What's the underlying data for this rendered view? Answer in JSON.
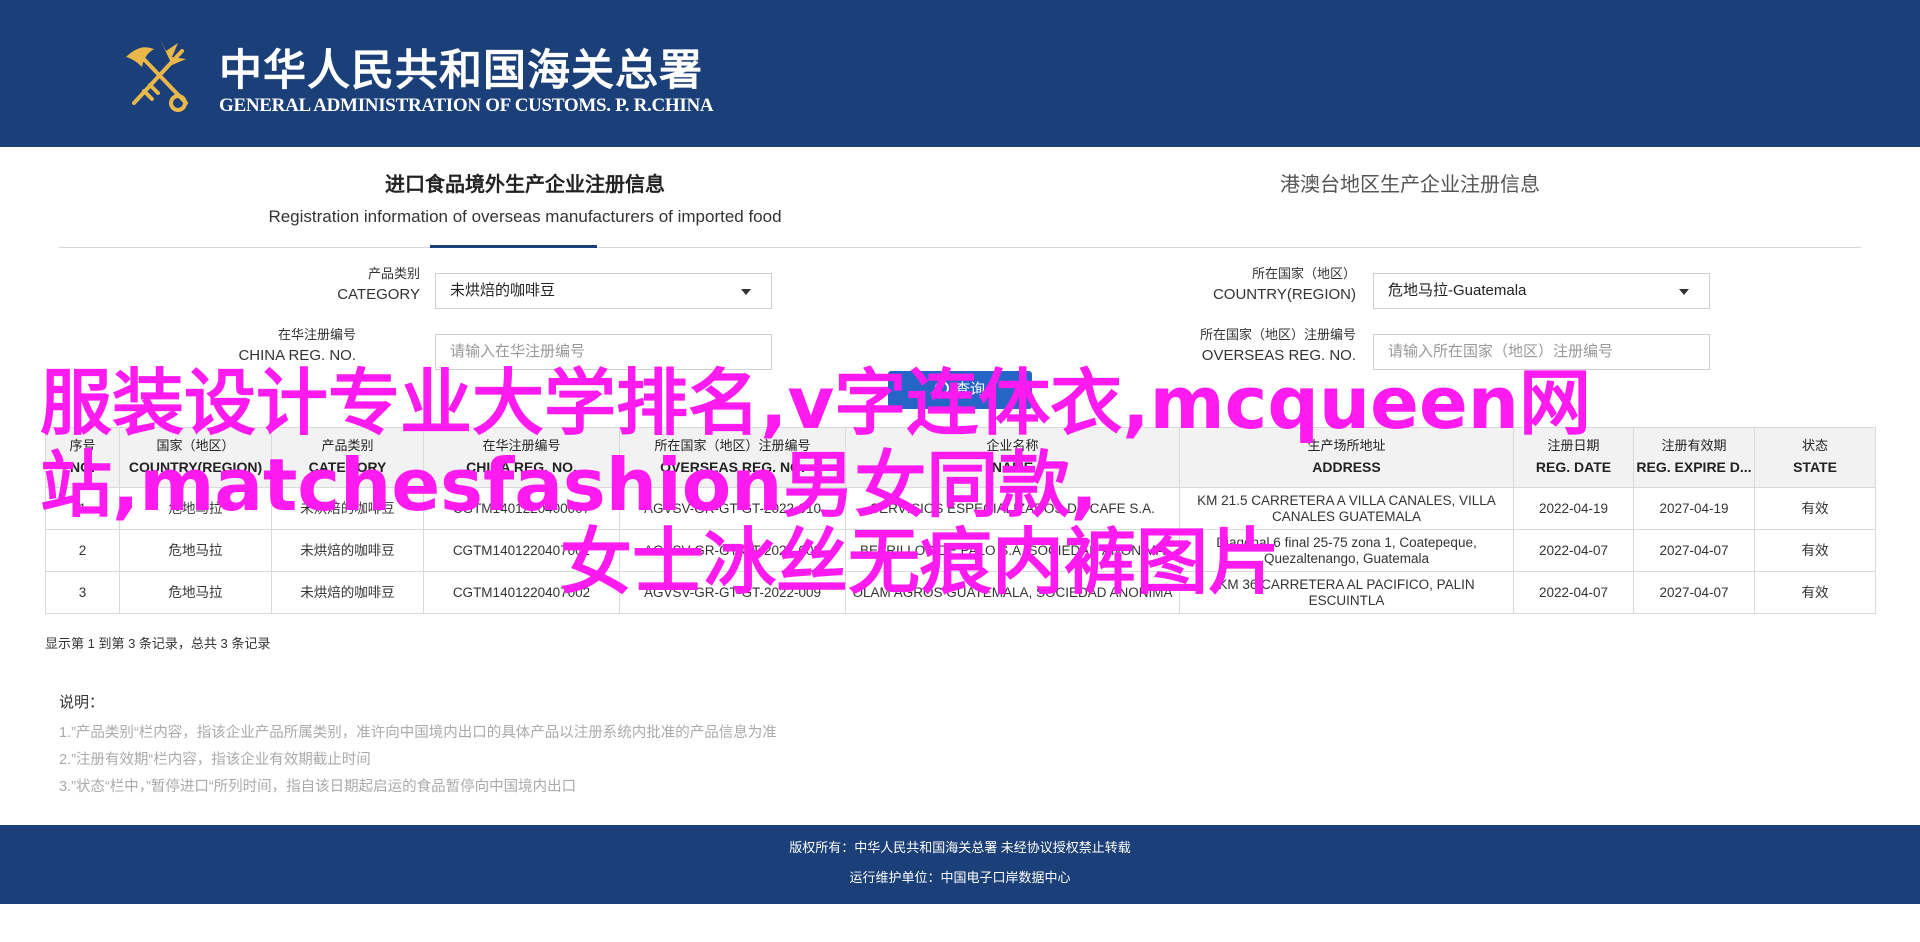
{
  "header": {
    "title_cn": "中华人民共和国海关总署",
    "title_en": "GENERAL ADMINISTRATION OF CUSTOMS. P. R.CHINA",
    "emblem_icon": "customs-emblem-icon"
  },
  "tabs": {
    "left_cn": "进口食品境外生产企业注册信息",
    "left_en": "Registration information of overseas manufacturers of imported food",
    "right_cn": "港澳台地区生产企业注册信息"
  },
  "form": {
    "category_label_cn": "产品类别",
    "category_label_en": "CATEGORY",
    "category_value": "未烘焙的咖啡豆",
    "country_label_cn": "所在国家（地区）",
    "country_label_en": "COUNTRY(REGION)",
    "country_value": "危地马拉-Guatemala",
    "china_reg_label_cn": "在华注册编号",
    "china_reg_label_en": "CHINA REG. NO.",
    "china_reg_placeholder": "请输入在华注册编号",
    "overseas_reg_label_cn": "所在国家（地区）注册编号",
    "overseas_reg_label_en": "OVERSEAS REG. NO.",
    "overseas_reg_placeholder": "请输入所在国家（地区）注册编号",
    "search_label": "查询"
  },
  "table": {
    "headers": [
      {
        "cn": "序号",
        "en": "NO."
      },
      {
        "cn": "国家（地区）",
        "en": "COUNTRY(REGION)"
      },
      {
        "cn": "产品类别",
        "en": "CATEGORY"
      },
      {
        "cn": "在华注册编号",
        "en": "CHINA REG. NO."
      },
      {
        "cn": "所在国家（地区）注册编号",
        "en": "OVERSEAS REG. NO."
      },
      {
        "cn": "企业名称",
        "en": "NAME"
      },
      {
        "cn": "生产场所地址",
        "en": "ADDRESS"
      },
      {
        "cn": "注册日期",
        "en": "REG. DATE"
      },
      {
        "cn": "注册有效期",
        "en": "REG. EXPIRE D..."
      },
      {
        "cn": "状态",
        "en": "STATE"
      }
    ],
    "rows": [
      {
        "no": "1",
        "country": "危地马拉",
        "category": "未烘焙的咖啡豆",
        "china_reg": "CGTM1401220400007",
        "overseas_reg": "AGVSV-GR-GT-GT-2022-010",
        "name": "SERVICIOS ESPECIALIZADOS DE CAFE S.A.",
        "address": "KM 21.5 CARRETERA A VILLA CANALES, VILLA CANALES GUATEMALA",
        "reg_date": "2022-04-19",
        "expire": "2027-04-19",
        "state": "有效"
      },
      {
        "no": "2",
        "country": "危地马拉",
        "category": "未烘焙的咖啡豆",
        "china_reg": "CGTM1401220407002",
        "overseas_reg": "AGVSV-GR-GT-GT-2022-008",
        "name": "BETRILLOS DE PALO S.A. SOCIEDAD ANONIMA",
        "address": "Diagonal 6 final 25-75 zona 1, Coatepeque, Quezaltenango, Guatemala",
        "reg_date": "2022-04-07",
        "expire": "2027-04-07",
        "state": "有效"
      },
      {
        "no": "3",
        "country": "危地马拉",
        "category": "未烘焙的咖啡豆",
        "china_reg": "CGTM1401220407002",
        "overseas_reg": "AGVSV-GR-GT-GT-2022-009",
        "name": "OLAM AGROS GUATEMALA, SOCIEDAD ANONIMA",
        "address": "KM 36 CARRETERA AL PACIFICO, PALIN ESCUINTLA",
        "reg_date": "2022-04-07",
        "expire": "2027-04-07",
        "state": "有效"
      }
    ]
  },
  "records_text": "显示第 1 到第 3 条记录，总共 3 条记录",
  "notes": {
    "title": "说明：",
    "items": [
      "1.”产品类别“栏内容，指该企业产品所属类别，准许向中国境内出口的具体产品以注册系统内批准的产品信息为准",
      "2.”注册有效期“栏内容，指该企业有效期截止时间",
      "3.”状态“栏中，”暂停进口“所列时间，指自该日期起启运的食品暂停向中国境内出口"
    ]
  },
  "footer": {
    "line1": "版权所有：中华人民共和国海关总署 未经协议授权禁止转载",
    "line2": "运行维护单位：中国电子口岸数据中心"
  },
  "overlay": {
    "line1": "服装设计专业大学排名,v字连体衣,mcqueen网站,matchesfashion男女同款,",
    "line2": "女士冰丝无痕内裤图片"
  },
  "colors": {
    "brand": "#1b3f78",
    "button": "#2465c6",
    "overlay": "#ff1af0"
  }
}
